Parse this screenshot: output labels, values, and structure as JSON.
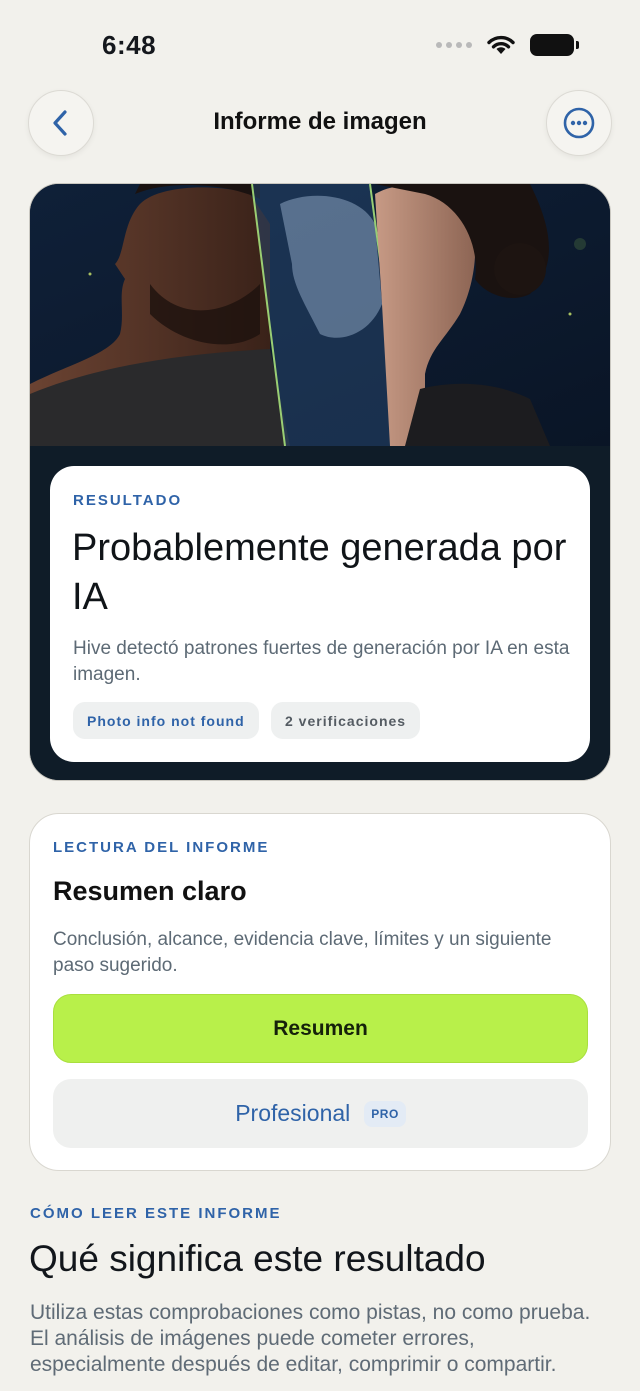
{
  "status_bar": {
    "time": "6:48"
  },
  "nav": {
    "title": "Informe de imagen",
    "back_icon": "chevron-left-icon",
    "more_icon": "ellipsis-circle-icon"
  },
  "result": {
    "eyebrow": "RESULTADO",
    "title": "Probablemente generada por IA",
    "description": "Hive detectó patrones fuertes de generación por IA en esta imagen.",
    "chips": [
      "Photo info not found",
      "2 verificaciones"
    ]
  },
  "report": {
    "eyebrow": "LECTURA DEL INFORME",
    "title": "Resumen claro",
    "description": "Conclusión, alcance, evidencia clave, límites y un siguiente paso sugerido.",
    "summary_button": "Resumen",
    "pro_button": "Profesional",
    "pro_badge": "PRO"
  },
  "explanation": {
    "eyebrow": "CÓMO LEER ESTE INFORME",
    "title": "Qué significa este resultado",
    "body": "Utiliza estas comprobaciones como pistas, no como prueba. El análisis de imágenes puede cometer errores, especialmente después de editar, comprimir o compartir."
  },
  "colors": {
    "accent": "#2f63a8",
    "primary_button": "#b8f04a",
    "background": "#f2f1ec",
    "hero_dark": "#0f1c28"
  }
}
